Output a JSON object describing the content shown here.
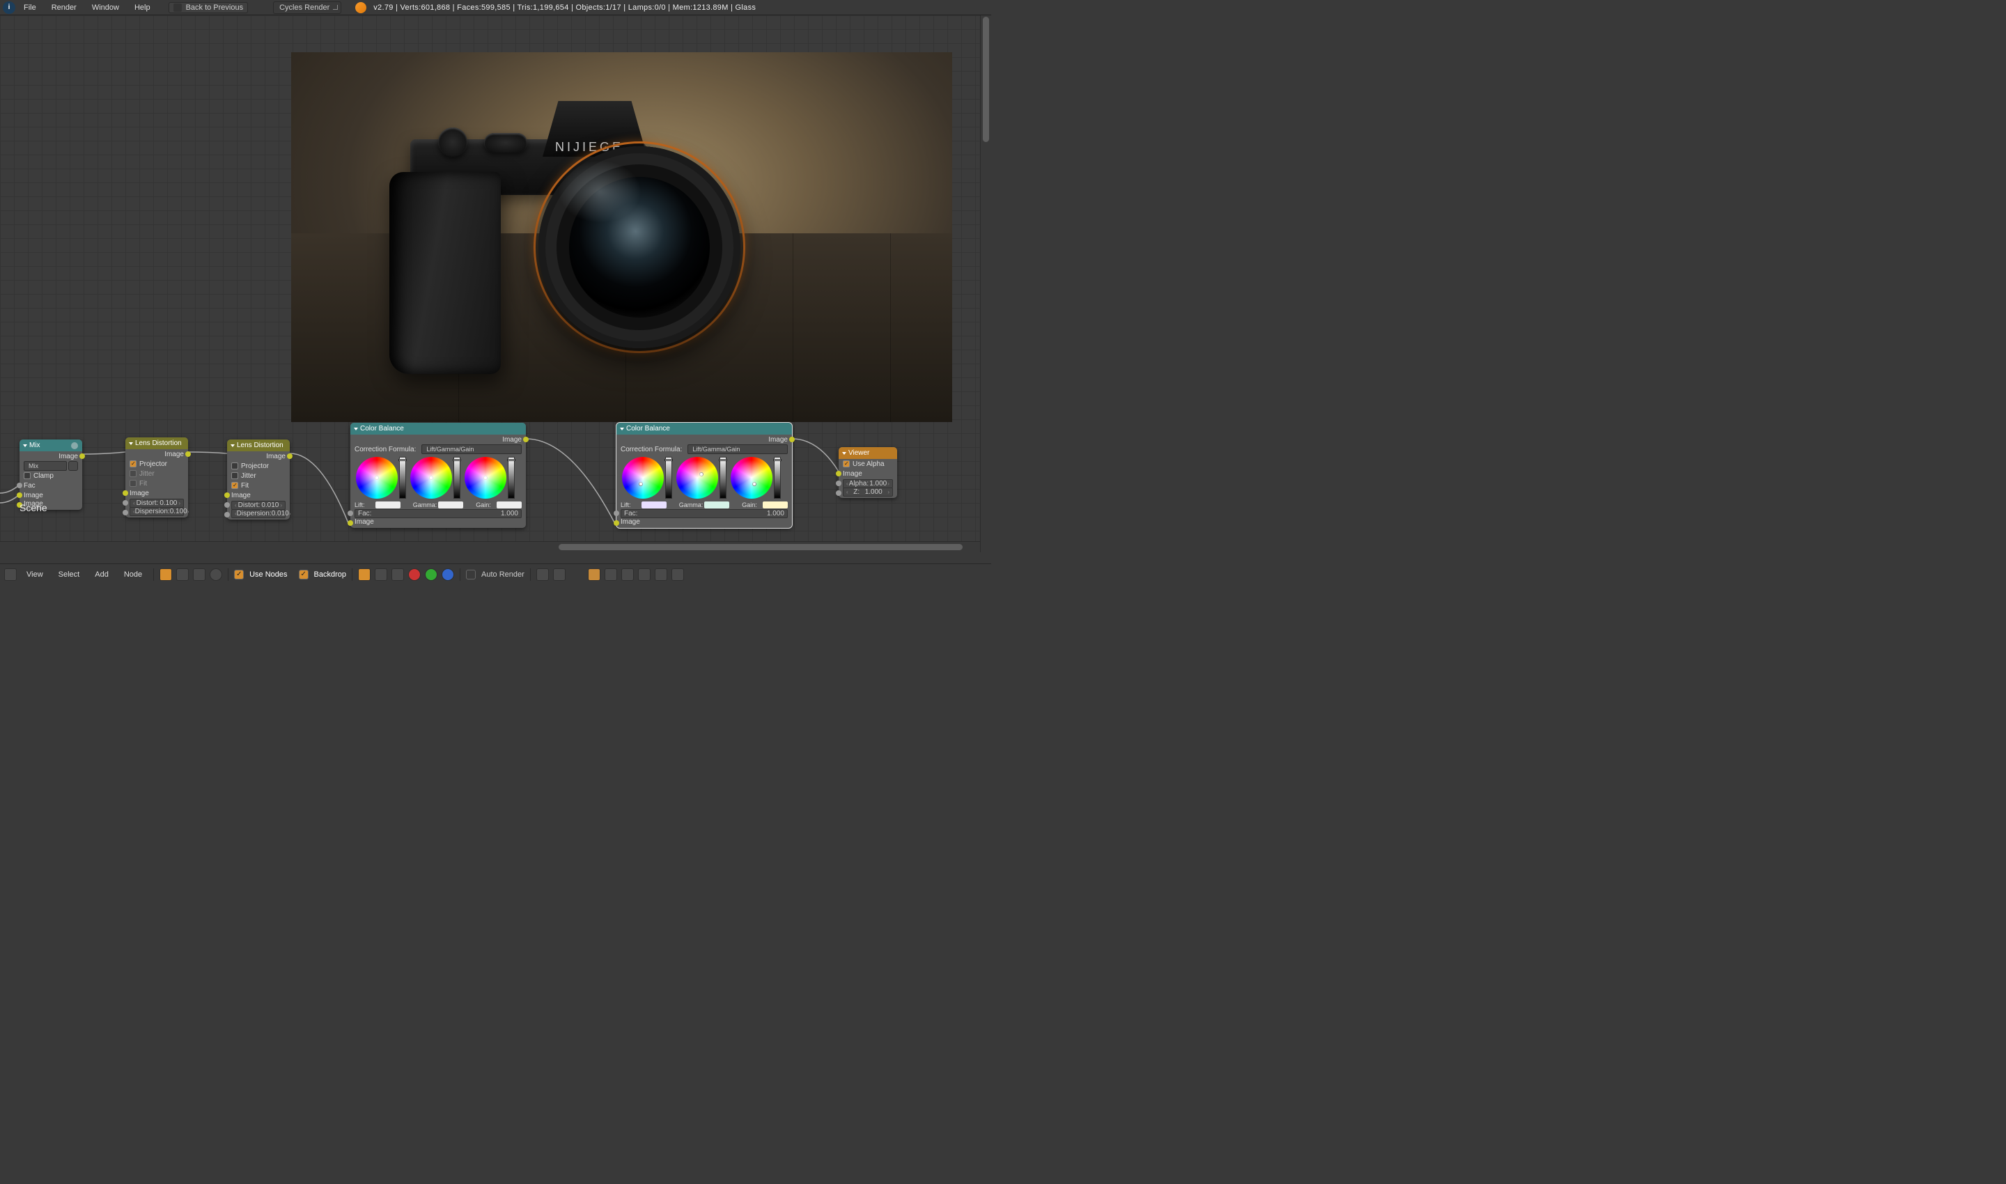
{
  "topbar": {
    "menus": [
      "File",
      "Render",
      "Window",
      "Help"
    ],
    "back_label": "Back to Previous",
    "engine": "Cycles Render",
    "stats": "v2.79 | Verts:601,868 | Faces:599,585 | Tris:1,199,654 | Objects:1/17 | Lamps:0/0 | Mem:1213.89M | Glass"
  },
  "backdrop": {
    "brand": "NIJIEGE"
  },
  "scene_label": "Scene",
  "nodes": {
    "mix": {
      "title": "Mix",
      "out_image": "Image",
      "blend_mode": "Mix",
      "clamp": "Clamp",
      "inputs": [
        "Fac",
        "Image",
        "Image"
      ]
    },
    "lens1": {
      "title": "Lens Distortion",
      "out_image": "Image",
      "projector": "Projector",
      "jitter": "Jitter",
      "fit": "Fit",
      "in_image": "Image",
      "distort_label": "Distort:",
      "distort_val": "0.100",
      "dispersion_label": "Dispersion:",
      "dispersion_val": "0.100",
      "projector_on": true,
      "jitter_on": false,
      "fit_on": false
    },
    "lens2": {
      "title": "Lens Distortion",
      "out_image": "Image",
      "projector": "Projector",
      "jitter": "Jitter",
      "fit": "Fit",
      "in_image": "Image",
      "distort_label": "Distort:",
      "distort_val": "0.010",
      "dispersion_label": "Dispersion:",
      "dispersion_val": "0.010",
      "projector_on": false,
      "jitter_on": false,
      "fit_on": true
    },
    "cb1": {
      "title": "Color Balance",
      "out_image": "Image",
      "formula_label": "Correction Formula:",
      "formula": "Lift/Gamma/Gain",
      "lift": "Lift:",
      "gamma": "Gamma:",
      "gain": "Gain:",
      "fac_label": "Fac:",
      "fac_val": "1.000",
      "in_image": "Image"
    },
    "cb2": {
      "title": "Color Balance",
      "out_image": "Image",
      "formula_label": "Correction Formula:",
      "formula": "Lift/Gamma/Gain",
      "lift": "Lift:",
      "gamma": "Gamma:",
      "gain": "Gain:",
      "fac_label": "Fac:",
      "fac_val": "1.000",
      "in_image": "Image"
    },
    "viewer": {
      "title": "Viewer",
      "use_alpha_label": "Use Alpha",
      "in_image": "Image",
      "alpha_label": "Alpha:",
      "alpha_val": "1.000",
      "z_label": "Z:",
      "z_val": "1.000"
    }
  },
  "bottombar": {
    "menus": [
      "View",
      "Select",
      "Add",
      "Node"
    ],
    "use_nodes": "Use Nodes",
    "backdrop": "Backdrop",
    "auto_render": "Auto Render"
  }
}
